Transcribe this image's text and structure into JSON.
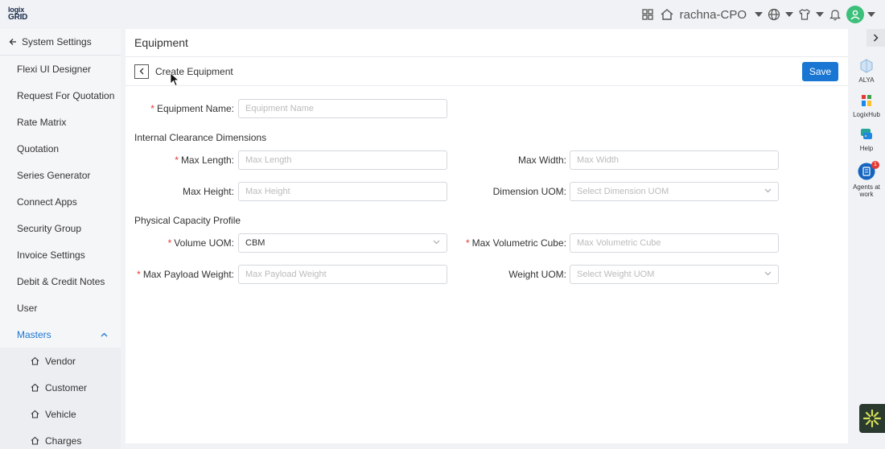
{
  "topbar": {
    "logo_line1": "logix",
    "logo_line2": "GRID",
    "user_name": "rachna-CPO",
    "icons": [
      "grid-icon",
      "home-icon",
      "globe-icon",
      "shirt-icon",
      "bell-icon",
      "user-avatar-icon"
    ]
  },
  "sidebar": {
    "header": "System Settings",
    "items": [
      {
        "label": "Flexi UI Designer"
      },
      {
        "label": "Request For Quotation"
      },
      {
        "label": "Rate Matrix"
      },
      {
        "label": "Quotation"
      },
      {
        "label": "Series Generator"
      },
      {
        "label": "Connect Apps"
      },
      {
        "label": "Security Group"
      },
      {
        "label": "Invoice Settings"
      },
      {
        "label": "Debit & Credit Notes"
      },
      {
        "label": "User"
      },
      {
        "label": "Masters"
      }
    ],
    "sub_items": [
      {
        "label": "Vendor"
      },
      {
        "label": "Customer"
      },
      {
        "label": "Vehicle"
      },
      {
        "label": "Charges"
      }
    ]
  },
  "main": {
    "title": "Equipment",
    "subtitle": "Create Equipment",
    "save_label": "Save",
    "sections": {
      "internal": "Internal Clearance Dimensions",
      "physical": "Physical Capacity Profile"
    },
    "fields": {
      "equipment_name": {
        "label": "Equipment Name",
        "placeholder": "Equipment Name",
        "required": true
      },
      "max_length": {
        "label": "Max Length",
        "placeholder": "Max Length",
        "required": true
      },
      "max_width": {
        "label": "Max Width",
        "placeholder": "Max Width",
        "required": false
      },
      "max_height": {
        "label": "Max Height",
        "placeholder": "Max Height",
        "required": false
      },
      "dimension_uom": {
        "label": "Dimension UOM",
        "placeholder": "Select Dimension UOM",
        "required": false
      },
      "volume_uom": {
        "label": "Volume UOM",
        "value": "CBM",
        "required": true
      },
      "max_volumetric_cube": {
        "label": "Max Volumetric Cube",
        "placeholder": "Max Volumetric Cube",
        "required": true
      },
      "max_payload_weight": {
        "label": "Max Payload Weight",
        "placeholder": "Max Payload Weight",
        "required": true
      },
      "weight_uom": {
        "label": "Weight UOM",
        "placeholder": "Select Weight UOM",
        "required": false
      }
    },
    "label_suffix": ":"
  },
  "rail": {
    "items": [
      {
        "label": "ALYA"
      },
      {
        "label": "LogixHub"
      },
      {
        "label": "Help"
      },
      {
        "label_line1": "Agents at",
        "label_line2": "work",
        "badge": "1"
      }
    ]
  },
  "colors": {
    "primary": "#1976d2",
    "required": "#e53935",
    "avatar": "#3cbf7a"
  }
}
